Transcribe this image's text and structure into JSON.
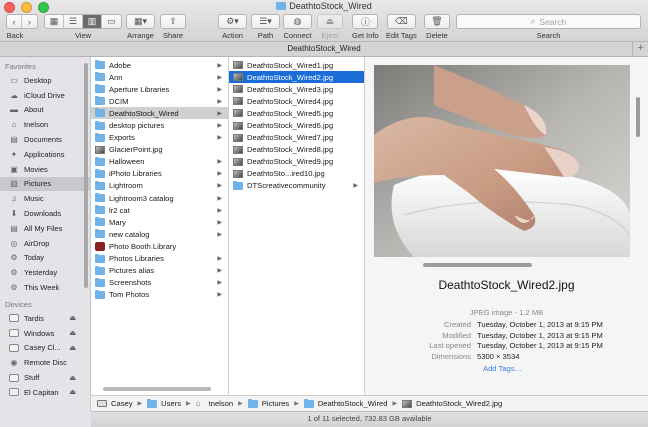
{
  "window": {
    "title": "DeathtoStock_Wired",
    "tab_title": "DeathtoStock_Wired",
    "traffic_lights": {
      "close": "#fc605b",
      "minimize": "#fdbc40",
      "zoom": "#34c84a"
    }
  },
  "toolbar": {
    "back_label": "Back",
    "view_label": "View",
    "arrange_label": "Arrange",
    "share_label": "Share",
    "action_label": "Action",
    "path_label": "Path",
    "connect_label": "Connect",
    "eject_label": "Eject",
    "get_info_label": "Get Info",
    "edit_tags_label": "Edit Tags",
    "delete_label": "Delete",
    "search_placeholder": "Search",
    "search_label": "Search",
    "icons": {
      "back": "chevron-left-icon",
      "forward": "chevron-right-icon",
      "view_icons": "icon-view-icon",
      "view_list": "list-view-icon",
      "view_columns": "column-view-icon",
      "view_coverflow": "coverflow-view-icon",
      "arrange": "arrange-icon",
      "share": "share-icon",
      "action": "gear-icon",
      "path": "path-icon",
      "connect": "globe-icon",
      "eject": "eject-icon",
      "get_info": "info-icon",
      "edit_tags": "tag-icon",
      "delete": "trash-icon",
      "search": "search-icon"
    }
  },
  "sidebar": {
    "favorites_header": "Favorites",
    "favorites": [
      {
        "label": "Desktop",
        "icon": "desktop-icon"
      },
      {
        "label": "iCloud Drive",
        "icon": "cloud-icon"
      },
      {
        "label": "About",
        "icon": "folder-icon"
      },
      {
        "label": "tnelson",
        "icon": "home-icon"
      },
      {
        "label": "Documents",
        "icon": "documents-icon"
      },
      {
        "label": "Applications",
        "icon": "applications-icon"
      },
      {
        "label": "Movies",
        "icon": "movies-icon"
      },
      {
        "label": "Pictures",
        "icon": "pictures-icon",
        "selected": true
      },
      {
        "label": "Music",
        "icon": "music-icon"
      },
      {
        "label": "Downloads",
        "icon": "downloads-icon"
      },
      {
        "label": "All My Files",
        "icon": "all-files-icon"
      },
      {
        "label": "AirDrop",
        "icon": "airdrop-icon"
      },
      {
        "label": "Today",
        "icon": "smart-folder-icon"
      },
      {
        "label": "Yesterday",
        "icon": "smart-folder-icon"
      },
      {
        "label": "This Week",
        "icon": "smart-folder-icon"
      }
    ],
    "devices_header": "Devices",
    "devices": [
      {
        "label": "Tardis",
        "icon": "drive-icon",
        "eject": true
      },
      {
        "label": "Windows",
        "icon": "drive-icon",
        "eject": true
      },
      {
        "label": "Casey Cl...",
        "icon": "drive-icon",
        "eject": true
      },
      {
        "label": "Remote Disc",
        "icon": "disc-icon",
        "eject": false
      },
      {
        "label": "Stuff",
        "icon": "drive-icon",
        "eject": true
      },
      {
        "label": "El Capitan",
        "icon": "drive-icon",
        "eject": true
      }
    ]
  },
  "column1": [
    {
      "label": "Adobe",
      "type": "folder",
      "arrow": true
    },
    {
      "label": "Ann",
      "type": "folder",
      "arrow": true
    },
    {
      "label": "Aperture Libraries",
      "type": "folder",
      "arrow": true
    },
    {
      "label": "DCIM",
      "type": "folder",
      "arrow": true
    },
    {
      "label": "DeathtoStock_Wired",
      "type": "folder",
      "arrow": true,
      "selected": true
    },
    {
      "label": "desktop pictures",
      "type": "folder",
      "arrow": true
    },
    {
      "label": "Exports",
      "type": "folder",
      "arrow": true
    },
    {
      "label": "GlacierPoint.jpg",
      "type": "image",
      "arrow": false
    },
    {
      "label": "Halloween",
      "type": "folder",
      "arrow": true
    },
    {
      "label": "iPhoto Libraries",
      "type": "folder",
      "arrow": true
    },
    {
      "label": "Lightroom",
      "type": "folder",
      "arrow": true
    },
    {
      "label": "Lightroom3 catalog",
      "type": "folder",
      "arrow": true
    },
    {
      "label": "lr2 cat",
      "type": "folder",
      "arrow": true
    },
    {
      "label": "Mary",
      "type": "folder",
      "arrow": true
    },
    {
      "label": "new catalog",
      "type": "folder",
      "arrow": true
    },
    {
      "label": "Photo Booth Library",
      "type": "photobooth",
      "arrow": false
    },
    {
      "label": "Photos Libraries",
      "type": "folder",
      "arrow": true
    },
    {
      "label": "Pictures alias",
      "type": "folder",
      "arrow": true
    },
    {
      "label": "Screenshots",
      "type": "folder",
      "arrow": true
    },
    {
      "label": "Tom Photos",
      "type": "folder",
      "arrow": true
    }
  ],
  "column2": [
    {
      "label": "DeathtoStock_Wired1.jpg",
      "type": "image",
      "arrow": false
    },
    {
      "label": "DeathtoStock_Wired2.jpg",
      "type": "image",
      "arrow": false,
      "selected": true
    },
    {
      "label": "DeathtoStock_Wired3.jpg",
      "type": "image",
      "arrow": false
    },
    {
      "label": "DeathtoStock_Wired4.jpg",
      "type": "image",
      "arrow": false
    },
    {
      "label": "DeathtoStock_Wired5.jpg",
      "type": "image",
      "arrow": false
    },
    {
      "label": "DeathtoStock_Wired6.jpg",
      "type": "image",
      "arrow": false
    },
    {
      "label": "DeathtoStock_Wired7.jpg",
      "type": "image",
      "arrow": false
    },
    {
      "label": "DeathtoStock_Wired8.jpg",
      "type": "image",
      "arrow": false
    },
    {
      "label": "DeathtoStock_Wired9.jpg",
      "type": "image",
      "arrow": false
    },
    {
      "label": "DeathtoSto...ired10.jpg",
      "type": "image",
      "arrow": false
    },
    {
      "label": "DTScreativecommunity",
      "type": "folder",
      "arrow": true
    }
  ],
  "preview": {
    "filename": "DeathtoStock_Wired2.jpg",
    "kind": "JPEG image - 1.2 MB",
    "meta": [
      {
        "key": "Created",
        "value": "Tuesday, October 1, 2013 at 9:15 PM"
      },
      {
        "key": "Modified",
        "value": "Tuesday, October 1, 2013 at 9:15 PM"
      },
      {
        "key": "Last opened",
        "value": "Tuesday, October 1, 2013 at 9:15 PM"
      },
      {
        "key": "Dimensions",
        "value": "5300 × 3534"
      }
    ],
    "add_tags": "Add Tags…"
  },
  "pathbar": [
    {
      "label": "Casey",
      "icon": "drive-icon"
    },
    {
      "label": "Users",
      "icon": "folder-icon"
    },
    {
      "label": "tnelson",
      "icon": "home-icon"
    },
    {
      "label": "Pictures",
      "icon": "folder-icon"
    },
    {
      "label": "DeathtoStock_Wired",
      "icon": "folder-icon"
    },
    {
      "label": "DeathtoStock_Wired2.jpg",
      "icon": "image-icon"
    }
  ],
  "status": "1 of 11 selected, 732.83 GB available",
  "colors": {
    "selection_blue": "#1a6cd6",
    "folder_blue": "#6fb3e8",
    "link_blue": "#3b7ed7"
  }
}
